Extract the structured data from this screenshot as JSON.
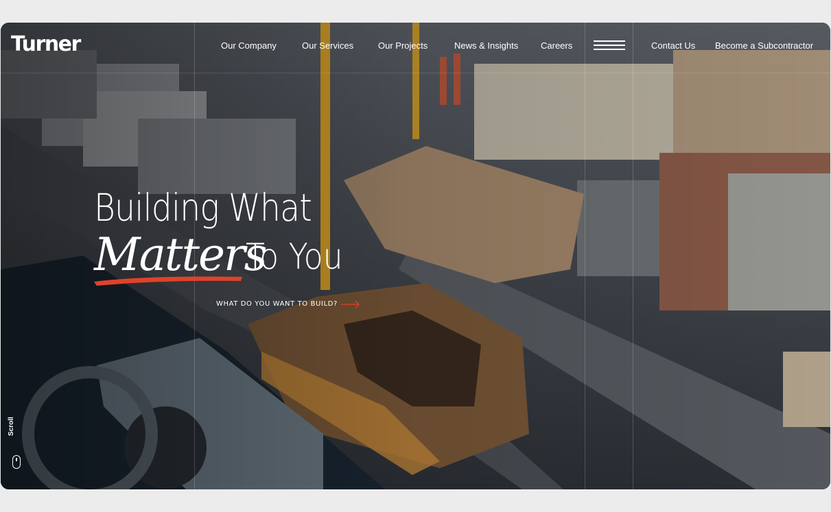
{
  "brand": {
    "logo_text": "Turner"
  },
  "nav": {
    "items": [
      {
        "label": "Our Company"
      },
      {
        "label": "Our Services"
      },
      {
        "label": "Our Projects"
      },
      {
        "label": "News & Insights"
      },
      {
        "label": "Careers"
      }
    ],
    "menu_icon": "hamburger-icon",
    "right_items": [
      {
        "label": "Contact Us"
      },
      {
        "label": "Become a Subcontractor"
      }
    ]
  },
  "hero": {
    "line1": "Building What",
    "script_word": "Matters",
    "line2_rest": "To You",
    "cta_label": "WHAT DO YOU WANT TO BUILD?",
    "cta_icon": "arrow-right-icon",
    "accent_color": "#e0422a"
  },
  "scroll": {
    "label": "Scroll",
    "icon": "mouse-icon"
  }
}
